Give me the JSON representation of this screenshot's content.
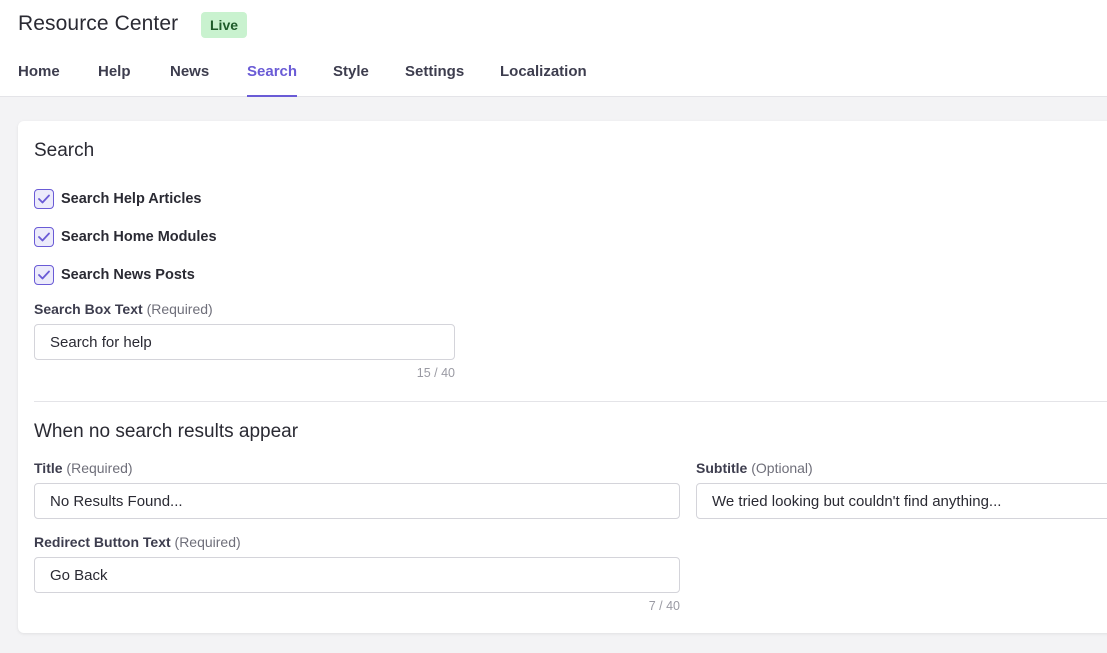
{
  "header": {
    "title": "Resource Center",
    "status_badge": "Live"
  },
  "tabs": [
    {
      "label": "Home"
    },
    {
      "label": "Help"
    },
    {
      "label": "News"
    },
    {
      "label": "Search",
      "active": true
    },
    {
      "label": "Style"
    },
    {
      "label": "Settings"
    },
    {
      "label": "Localization"
    }
  ],
  "search_section": {
    "title": "Search",
    "checkboxes": [
      {
        "label": "Search Help Articles",
        "checked": true
      },
      {
        "label": "Search Home Modules",
        "checked": true
      },
      {
        "label": "Search News Posts",
        "checked": true
      }
    ],
    "search_box": {
      "label": "Search Box Text",
      "required": "(Required)",
      "value": "Search for help",
      "counter": "15 / 40"
    }
  },
  "no_results_section": {
    "title": "When no search results appear",
    "title_field": {
      "label": "Title",
      "required": "(Required)",
      "value": "No Results Found..."
    },
    "subtitle_field": {
      "label": "Subtitle",
      "optional": "(Optional)",
      "value": "We tried looking but couldn't find anything..."
    },
    "redirect_field": {
      "label": "Redirect Button Text",
      "required": "(Required)",
      "value": "Go Back",
      "counter": "7 / 40"
    }
  },
  "colors": {
    "accent": "#6a5bd6",
    "live_badge_bg": "#c9f2cf",
    "live_badge_text": "#1e5b2a",
    "page_bg": "#f3f3f5"
  },
  "icons": {
    "checkbox_check": "checkmark-icon"
  }
}
